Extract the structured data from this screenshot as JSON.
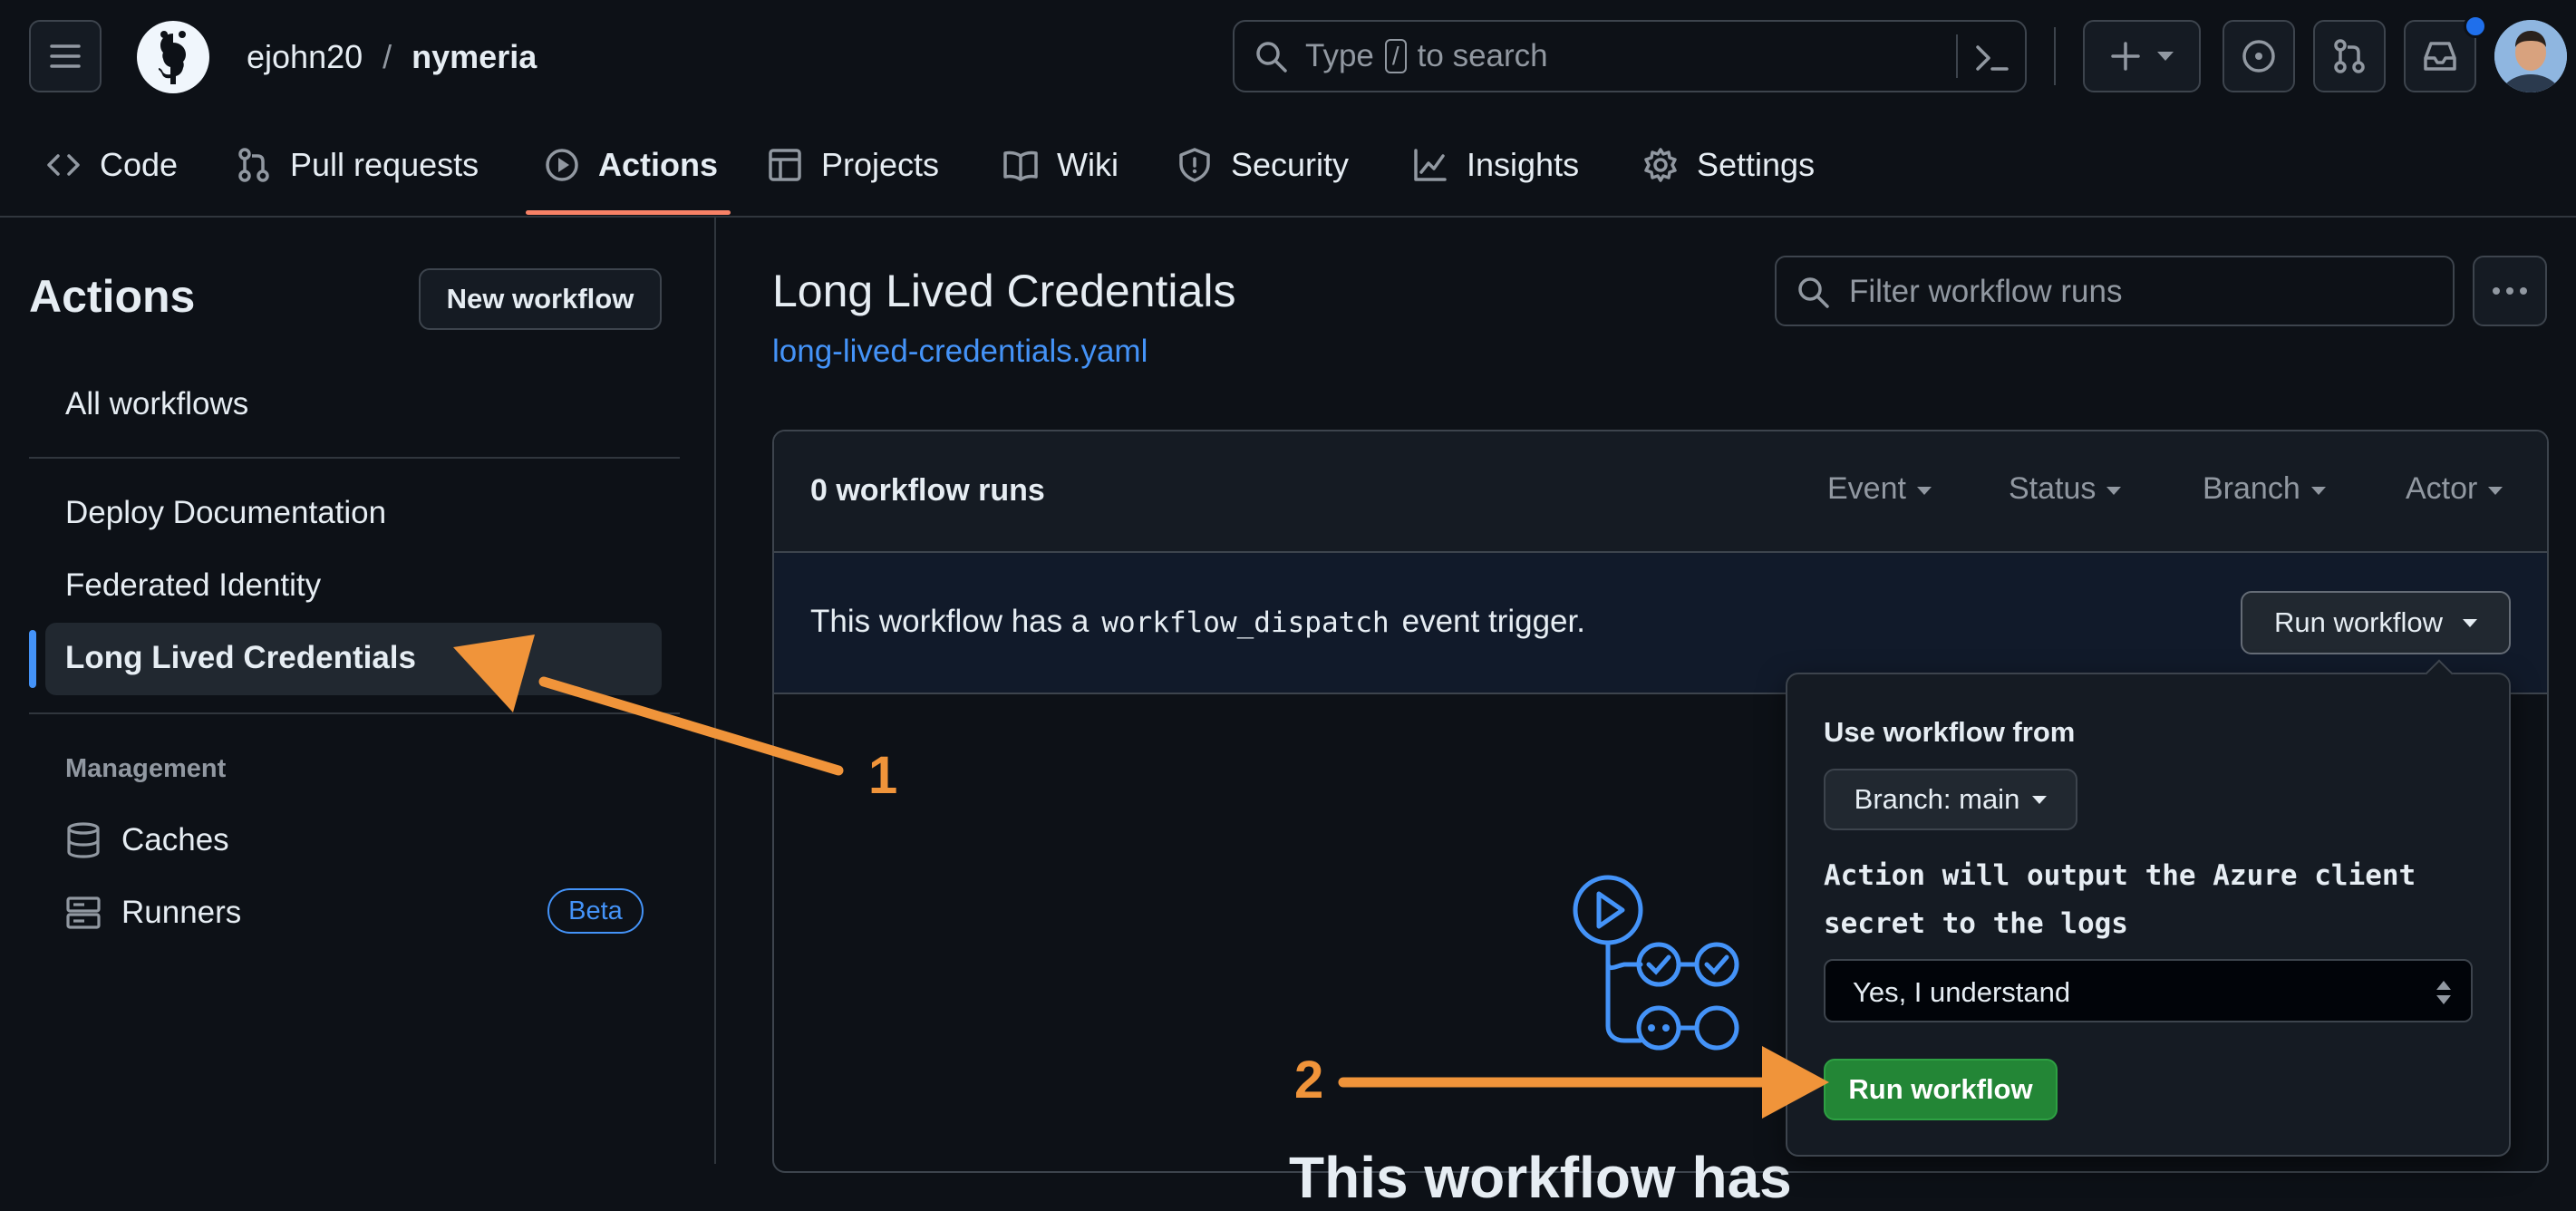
{
  "header": {
    "owner": "ejohn20",
    "separator": "/",
    "repo": "nymeria",
    "search": {
      "prefix": "Type",
      "key": "/",
      "suffix": "to search"
    }
  },
  "repo_nav": {
    "items": [
      {
        "label": "Code",
        "icon": "code-icon"
      },
      {
        "label": "Pull requests",
        "icon": "git-pull-request-icon"
      },
      {
        "label": "Actions",
        "icon": "play-icon",
        "active": true
      },
      {
        "label": "Projects",
        "icon": "table-icon"
      },
      {
        "label": "Wiki",
        "icon": "book-icon"
      },
      {
        "label": "Security",
        "icon": "shield-icon"
      },
      {
        "label": "Insights",
        "icon": "graph-icon"
      },
      {
        "label": "Settings",
        "icon": "gear-icon"
      }
    ]
  },
  "sidebar": {
    "title": "Actions",
    "new_workflow_label": "New workflow",
    "all_workflows": "All workflows",
    "workflows": [
      "Deploy Documentation",
      "Federated Identity",
      "Long Lived Credentials"
    ],
    "management_heading": "Management",
    "management_items": [
      {
        "label": "Caches",
        "icon": "database-icon"
      },
      {
        "label": "Runners",
        "icon": "server-icon",
        "badge": "Beta"
      }
    ]
  },
  "main": {
    "title": "Long Lived Credentials",
    "file_link": "long-lived-credentials.yaml",
    "filter_placeholder": "Filter workflow runs",
    "runs_count": "0 workflow runs",
    "filters": [
      "Event",
      "Status",
      "Branch",
      "Actor"
    ],
    "dispatch_text_before": "This workflow has a",
    "dispatch_code": "workflow_dispatch",
    "dispatch_text_after": "event trigger.",
    "run_workflow_label": "Run workflow",
    "empty_heading_partial": "This workflow has"
  },
  "dropdown": {
    "use_from_label": "Use workflow from",
    "branch_label": "Branch: main",
    "input_description": "Action will output the Azure client secret to the logs",
    "select_value": "Yes, I understand",
    "submit_label": "Run workflow"
  },
  "annotations": {
    "step1": "1",
    "step2": "2"
  },
  "colors": {
    "background": "#0d1117",
    "accent_link": "#4493f8",
    "nav_underline": "#f78166",
    "success_button": "#238636",
    "annotation_orange": "#f0943a",
    "notification_dot": "#1f6feb"
  }
}
